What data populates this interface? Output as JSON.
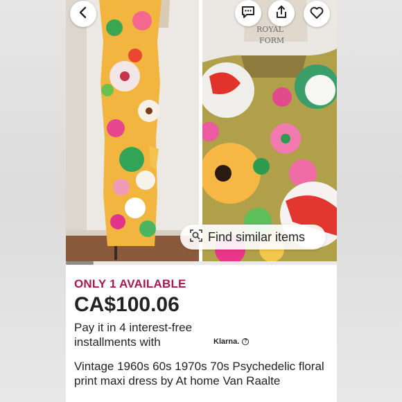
{
  "product": {
    "availability": "ONLY 1 AVAILABLE",
    "price": "CA$100.06",
    "installments_text": "Pay it in 4 interest-free installments with",
    "installments_provider": "Klarna.",
    "title": "Vintage 1960s 60s 1970s 70s Psychedelic floral print maxi dress by At home Van Raalte"
  },
  "gallery": {
    "find_similar_label": "Find similar items",
    "mannequin_label_line1": "ROYAL",
    "mannequin_label_line2": "FORM"
  },
  "toolbar": {
    "back_icon": "chevron-left-icon",
    "message_icon": "message-icon",
    "share_icon": "share-icon",
    "favorite_icon": "heart-icon"
  },
  "colors": {
    "availability": "#a61a4d",
    "text": "#222222",
    "background": "#ffffff"
  }
}
